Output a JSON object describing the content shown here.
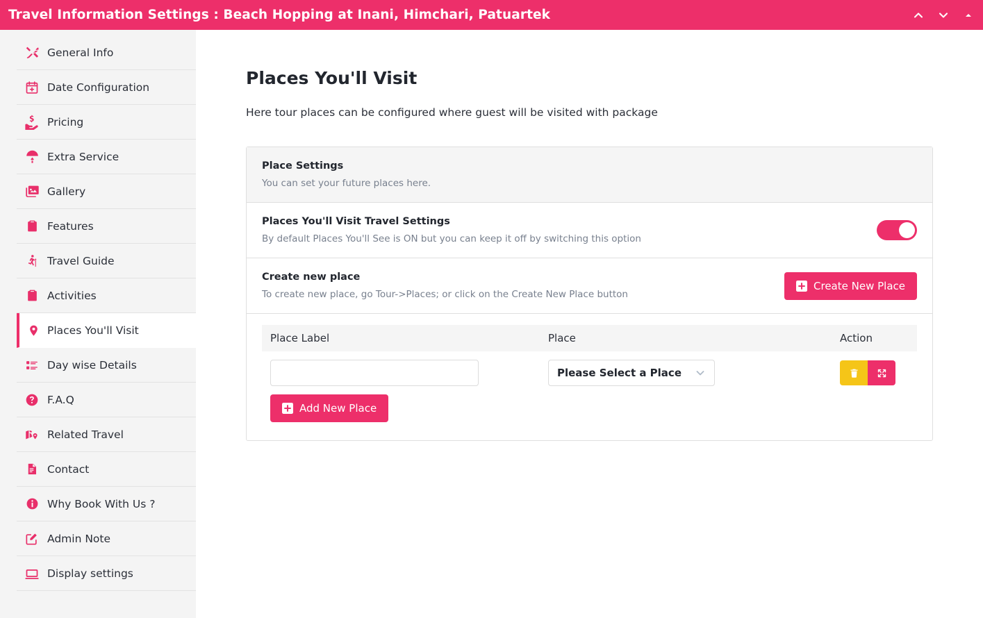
{
  "topbar": {
    "title": "Travel Information Settings : Beach Hopping at Inani, Himchari, Patuartek",
    "accent_color": "#ed2f6a",
    "controls": [
      {
        "name": "chevron-up-icon"
      },
      {
        "name": "chevron-down-icon"
      },
      {
        "name": "triangle-up-icon"
      }
    ]
  },
  "sidebar": {
    "items": [
      {
        "label": "General Info",
        "icon": "tools-icon",
        "active": false
      },
      {
        "label": "Date Configuration",
        "icon": "calendar-plus-icon",
        "active": false
      },
      {
        "label": "Pricing",
        "icon": "hand-dollar-icon",
        "active": false
      },
      {
        "label": "Extra Service",
        "icon": "parachute-icon",
        "active": false
      },
      {
        "label": "Gallery",
        "icon": "images-icon",
        "active": false
      },
      {
        "label": "Features",
        "icon": "clipboard-icon",
        "active": false
      },
      {
        "label": "Travel Guide",
        "icon": "hiking-icon",
        "active": false
      },
      {
        "label": "Activities",
        "icon": "clipboard-icon",
        "active": false
      },
      {
        "label": "Places You'll Visit",
        "icon": "map-marker-icon",
        "active": true
      },
      {
        "label": "Day wise Details",
        "icon": "list-icon",
        "active": false
      },
      {
        "label": "F.A.Q",
        "icon": "question-circle-icon",
        "active": false
      },
      {
        "label": "Related Travel",
        "icon": "map-marked-icon",
        "active": false
      },
      {
        "label": "Contact",
        "icon": "file-icon",
        "active": false
      },
      {
        "label": "Why Book With Us ?",
        "icon": "info-circle-icon",
        "active": false
      },
      {
        "label": "Admin Note",
        "icon": "edit-square-icon",
        "active": false
      },
      {
        "label": "Display settings",
        "icon": "monitor-icon",
        "active": false
      }
    ]
  },
  "main": {
    "page_title": "Places You'll Visit",
    "page_subtitle": "Here tour places can be configured where guest will be visited with package",
    "sections": {
      "place_settings": {
        "title": "Place Settings",
        "desc": "You can set your future places here."
      },
      "travel_settings": {
        "title": "Places You'll Visit Travel Settings",
        "desc": "By default Places You'll See is ON but you can keep it off by switching this option",
        "toggle_state": "on"
      },
      "create_new": {
        "title": "Create new place",
        "desc": "To create new place, go Tour->Places; or click on the Create New Place button",
        "button_label": "Create New Place"
      }
    },
    "table": {
      "headers": [
        "Place Label",
        "Place",
        "Action"
      ],
      "rows": [
        {
          "place_label_value": "",
          "place_label_placeholder": "",
          "place_select_value": "Please Select a Place",
          "actions": [
            "delete",
            "move"
          ]
        }
      ]
    },
    "add_button_label": "Add New Place"
  }
}
